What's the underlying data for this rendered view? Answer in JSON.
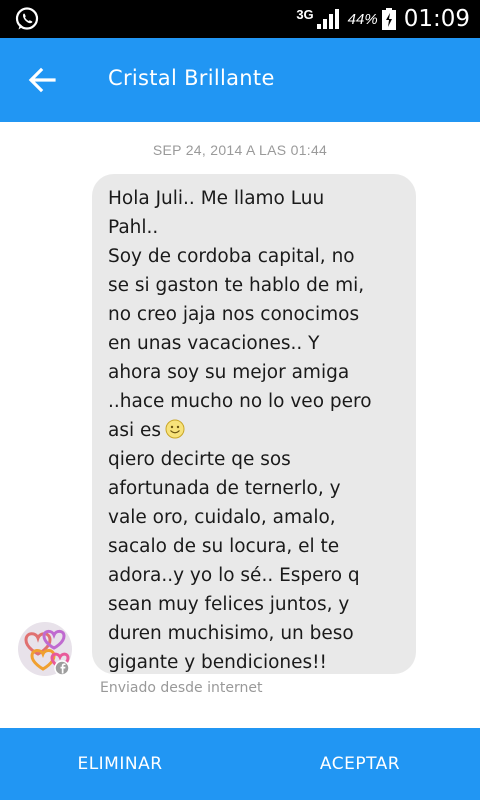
{
  "status_bar": {
    "network": "3G",
    "battery_percent": "44%",
    "time": "01:09",
    "icons": [
      "whatsapp-icon",
      "signal-icon",
      "battery-charging-icon"
    ]
  },
  "app_bar": {
    "title": "Cristal Brillante",
    "back_icon": "arrow-left-icon",
    "color": "#2196f3"
  },
  "conversation": {
    "timestamp": "SEP 24, 2014 A LAS 01:44",
    "message_lines": [
      "Hola Juli.. Me llamo Luu",
      "Pahl..",
      "Soy de cordoba capital, no",
      "se si gaston te hablo de mi,",
      "no creo jaja nos conocimos",
      "en unas vacaciones.. Y",
      "ahora soy su mejor amiga",
      "..hace mucho no lo veo pero",
      "asi es",
      "qiero decirte qe sos",
      "afortunada de ternerlo, y",
      "vale oro, cuidalo, amalo,",
      "sacalo de su locura, el te",
      "adora..y yo lo sé.. Espero q",
      "sean muy felices juntos, y",
      "duren muchisimo, un beso",
      "gigante y bendiciones!!"
    ],
    "emoji": "smiley-face-icon",
    "sent_from": "Enviado desde internet",
    "avatar_badge": "facebook-icon"
  },
  "actions": {
    "delete_label": "ELIMINAR",
    "accept_label": "ACEPTAR"
  }
}
